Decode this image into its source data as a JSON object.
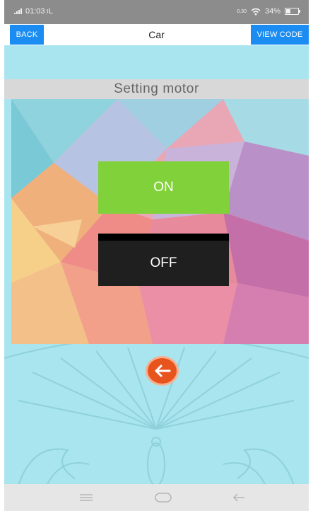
{
  "status_bar": {
    "time": "01:03",
    "carrier_mark": "ıL",
    "net_speed": "0.30",
    "battery_percent": "34%"
  },
  "toolbar": {
    "back_label": "BACK",
    "title": "Car",
    "view_code_label": "VIEW CODE"
  },
  "screen": {
    "heading": "Setting motor",
    "on_label": "ON",
    "off_label": "OFF",
    "back_icon": "arrow-left-icon"
  },
  "nav_bar": {
    "icons": [
      "menu-icon",
      "home-icon",
      "back-icon"
    ]
  },
  "colors": {
    "background": "#a8e5ee",
    "on_button": "#80d13a",
    "off_button": "#1f1f1f",
    "accent_button": "#1a8cf2",
    "arrow_button": "#e8541e"
  }
}
